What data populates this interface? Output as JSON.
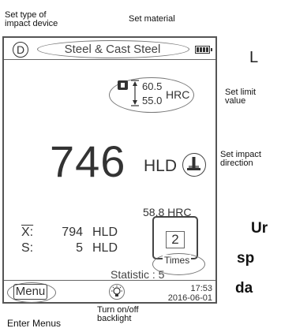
{
  "annotations": {
    "set_type_line1": "Set type of",
    "set_type_line2": "impact device",
    "set_material": "Set material",
    "set_limit_line1": "Set limit",
    "set_limit_line2": "value",
    "set_impact_line1": "Set impact",
    "set_impact_line2": "direction",
    "enter_menus": "Enter Menus",
    "backlight_line1": "Turn on/off",
    "backlight_line2": "backlight"
  },
  "screen": {
    "device_type": "D",
    "material": "Steel & Cast Steel",
    "limit_upper": "60.5",
    "limit_lower": "55.0",
    "limit_unit": "HRC",
    "main_value": "746",
    "main_unit": "HLD",
    "converted_value": "58.8 HRC",
    "mean_label": "X:",
    "mean_value": "794",
    "mean_unit": "HLD",
    "sd_label": "S:",
    "sd_value": "5",
    "sd_unit": "HLD",
    "times_count": "2",
    "times_label": "Times",
    "statistic_label": "Statistic : 5",
    "menu_label": "Menu",
    "time": "17:53",
    "date": "2016-06-01"
  },
  "side_text": {
    "line1": "Ur",
    "line2": "sp",
    "line3": "da"
  },
  "side_letter": "L",
  "colors": {
    "border": "#555555",
    "text": "#333333",
    "oval": "#777777"
  }
}
